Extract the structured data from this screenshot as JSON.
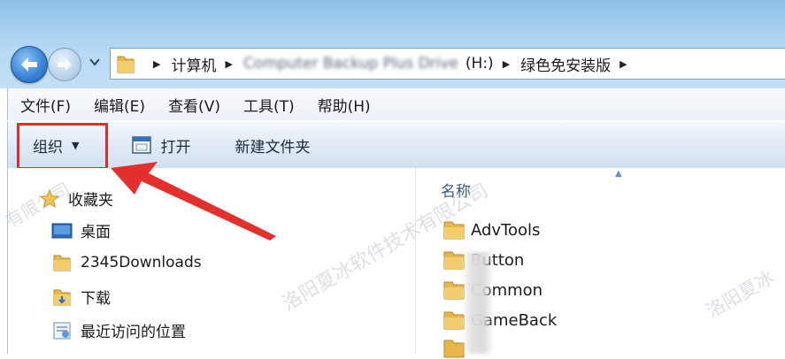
{
  "address": {
    "crumbs": [
      {
        "label": "计算机",
        "blurred": false
      },
      {
        "label": "Computer Backup Plus Drive",
        "blurred": true
      },
      {
        "label": "(H:)",
        "blurred": false
      },
      {
        "label": "绿色免安装版",
        "blurred": false
      }
    ]
  },
  "menubar": {
    "items": [
      "文件(F)",
      "编辑(E)",
      "查看(V)",
      "工具(T)",
      "帮助(H)"
    ]
  },
  "toolbar": {
    "organize_label": "组织",
    "organize_caret": "▼",
    "open_label": "打开",
    "new_folder_label": "新建文件夹"
  },
  "navpane": {
    "favorites_label": "收藏夹",
    "items": [
      "桌面",
      "2345Downloads",
      "下载",
      "最近访问的位置"
    ]
  },
  "filepane": {
    "column_name": "名称",
    "files": [
      "AdvTools",
      "Button",
      "Common",
      "GameBack"
    ]
  },
  "watermark": {
    "text_main": "洛阳夏冰软件技术有限公司",
    "text_left": "有限公司",
    "text_right": "洛阳夏冰"
  },
  "colors": {
    "highlight": "#e22b2b",
    "folder": "#e8b74a"
  }
}
